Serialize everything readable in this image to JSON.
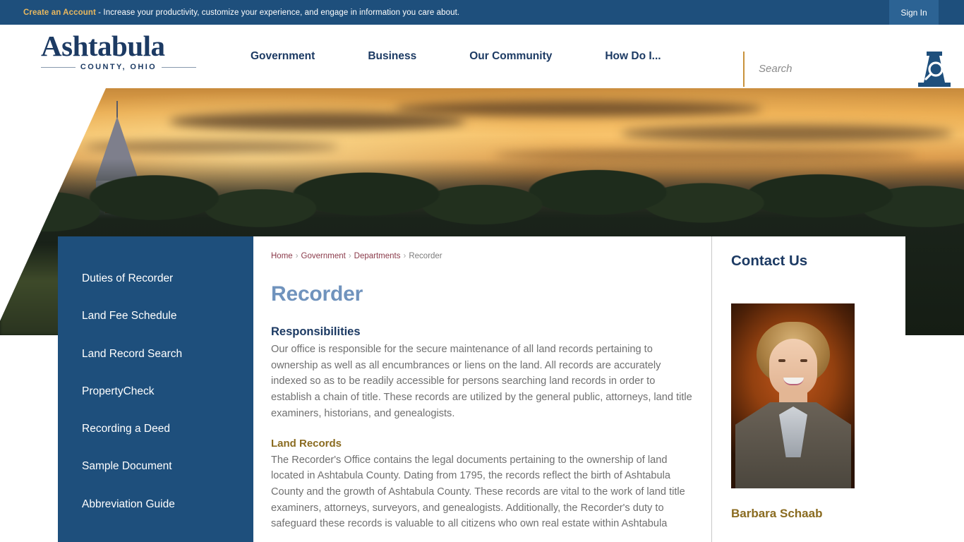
{
  "top_bar": {
    "create_account_label": "Create an Account",
    "message_suffix": " - Increase your productivity, customize your experience, and engage in information you care about.",
    "sign_in_label": "Sign In",
    "bg_color": "#1e4f7c",
    "accent_color": "#e8b85f"
  },
  "header": {
    "logo_name": "Ashtabula",
    "logo_subtitle": "COUNTY, OHIO",
    "nav_items": [
      {
        "label": "Government"
      },
      {
        "label": "Business"
      },
      {
        "label": "Our Community"
      },
      {
        "label": "How Do I..."
      }
    ],
    "search": {
      "placeholder": "Search",
      "value": "",
      "button_icon": "search-icon"
    },
    "brand_color": "#1c3a63",
    "divider_color": "#c8923c"
  },
  "hero": {
    "alt": "Church steeple at sunset over treeline in Ashtabula County"
  },
  "sidebar": {
    "items": [
      {
        "label": "Duties of Recorder"
      },
      {
        "label": "Land Fee Schedule"
      },
      {
        "label": "Land Record Search"
      },
      {
        "label": "PropertyCheck"
      },
      {
        "label": "Recording a Deed"
      },
      {
        "label": "Sample Document"
      },
      {
        "label": "Abbreviation Guide"
      }
    ],
    "bg_color": "#1e4f7c"
  },
  "breadcrumb": {
    "items": [
      {
        "label": "Home",
        "link": true
      },
      {
        "label": "Government",
        "link": true
      },
      {
        "label": "Departments",
        "link": true
      },
      {
        "label": "Recorder",
        "link": false
      }
    ],
    "separator": "›",
    "link_color": "#8a3a4a"
  },
  "main": {
    "page_title": "Recorder",
    "page_title_color": "#7093bd",
    "sections": [
      {
        "heading": "Responsibilities",
        "heading_color": "#1c3a63",
        "body": "Our office is responsible for the secure maintenance of all land records pertaining to ownership as well as all encumbrances or liens on the land. All records are accurately indexed so as to be readily accessible for persons searching land records in order to establish a chain of title. These records are utilized by the general public, attorneys, land title examiners, historians, and genealogists."
      },
      {
        "heading": "Land Records",
        "heading_color": "#8a6b20",
        "body": "The Recorder's Office contains the legal documents pertaining to the ownership of land located in Ashtabula County. Dating from 1795, the records reflect the birth of Ashtabula County and the growth of Ashtabula County. These records are vital to the work of land title examiners, attorneys, surveyors, and genealogists. Additionally, the Recorder's duty to safeguard these records is valuable to all citizens who own real estate within Ashtabula"
      }
    ]
  },
  "contact": {
    "title": "Contact Us",
    "title_color": "#1c3a63",
    "photo_alt": "Portrait of Barbara Schaab",
    "name": "Barbara Schaab",
    "name_color": "#8a6b20"
  }
}
